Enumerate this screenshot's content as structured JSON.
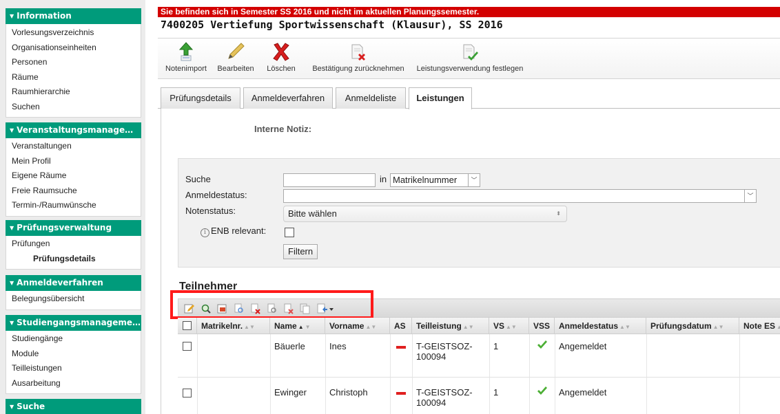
{
  "sidebar": {
    "sections": [
      {
        "title": "Information",
        "items": [
          "Vorlesungsverzeichnis",
          "Organisationseinheiten",
          "Personen",
          "Räume",
          "Raumhierarchie",
          "Suchen"
        ]
      },
      {
        "title": "Veranstaltungsmanageme...",
        "items": [
          "Veranstaltungen",
          "Mein Profil",
          "Eigene Räume",
          "Freie Raumsuche",
          "Termin-/Raumwünsche"
        ]
      },
      {
        "title": "Prüfungsverwaltung",
        "items": [
          "Prüfungen",
          "Prüfungsdetails"
        ]
      },
      {
        "title": "Anmeldeverfahren",
        "items": [
          "Belegungsübersicht"
        ]
      },
      {
        "title": "Studiengangsmanagement",
        "items": [
          "Studiengänge",
          "Module",
          "Teilleistungen",
          "Ausarbeitung"
        ]
      },
      {
        "title": "Suche",
        "items": []
      }
    ]
  },
  "banner": "Sie befinden sich in Semester SS 2016 und nicht im aktuellen Planungssemester.",
  "page_title": "7400205 Vertiefung Sportwissenschaft (Klausur), SS 2016",
  "toolbar": {
    "notenimport": "Notenimport",
    "bearbeiten": "Bearbeiten",
    "loeschen": "Löschen",
    "bestaetigung": "Bestätigung zurücknehmen",
    "leistungsverwendung": "Leistungsverwendung festlegen"
  },
  "tabs": [
    "Prüfungsdetails",
    "Anmeldeverfahren",
    "Anmeldeliste",
    "Leistungen"
  ],
  "active_tab": "Leistungen",
  "note_label": "Interne Notiz:",
  "filter": {
    "suche_label": "Suche",
    "in_label": "in",
    "search_field_value": "Matrikelnummer",
    "anmeldestatus_label": "Anmeldestatus:",
    "notenstatus_label": "Notenstatus:",
    "notenstatus_value": "Bitte wählen",
    "enb_label": "ENB relevant:",
    "filter_button": "Filtern"
  },
  "participants_title": "Teilnehmer",
  "table": {
    "headers": [
      "Matrikelnr.",
      "Name",
      "Vorname",
      "AS",
      "Teilleistung",
      "VS",
      "VSS",
      "Anmeldestatus",
      "Prüfungsdatum",
      "Note ES"
    ],
    "rows": [
      {
        "matrikelnr": "",
        "name": "Bäuerle",
        "vorname": "Ines",
        "teilleistung": "T-GEISTSOZ-100094",
        "vs": "1",
        "anmeldestatus": "Angemeldet",
        "pruefungsdatum": "",
        "note": ""
      },
      {
        "matrikelnr": "",
        "name": "Ewinger",
        "vorname": "Christoph",
        "teilleistung": "T-GEISTSOZ-100094",
        "vs": "1",
        "anmeldestatus": "Angemeldet",
        "pruefungsdatum": "",
        "note": ""
      }
    ]
  },
  "colors": {
    "nav_green": "#009b7b",
    "banner_red": "#d30000",
    "highlight_red": "#ff1a1a",
    "check_green": "#4caf35"
  }
}
